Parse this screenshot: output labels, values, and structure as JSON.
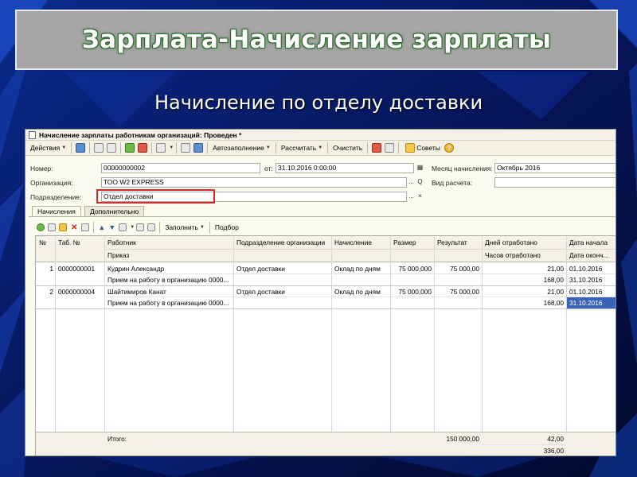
{
  "slide": {
    "title": "Зарплата-Начисление зарплаты",
    "subtitle": "Начисление по отделу доставки",
    "colors": {
      "title_bg": "#a6a6a6",
      "title_glow": "#2e6b2e",
      "background": "#04103a"
    }
  },
  "window": {
    "title": "Начисление зарплаты работникам организаций: Проведен *"
  },
  "toolbar": {
    "actions_label": "Действия",
    "autofill_label": "Автозаполнение",
    "calculate_label": "Рассчитать",
    "clear_label": "Очистить",
    "tips_label": "Советы",
    "help_symbol": "?"
  },
  "form": {
    "number_label": "Номер:",
    "number_value": "00000000002",
    "date_label": "от:",
    "date_value": "31.10.2016  0:00:00",
    "month_label": "Месяц начисления:",
    "month_value": "Октябрь 2016",
    "org_label": "Организация:",
    "org_value": "ТОО W2 EXPRESS",
    "calc_type_label": "Вид расчета:",
    "calc_type_value": "",
    "dept_label": "Подразделение:",
    "dept_value": "Отдел доставки",
    "select_button": "...",
    "search_button": "Q",
    "clear_button": "×"
  },
  "tabs": [
    {
      "label": "Начисления",
      "active": true
    },
    {
      "label": "Дополнительно",
      "active": false
    }
  ],
  "table_toolbar": {
    "fill_label": "Заполнить",
    "pick_label": "Подбор"
  },
  "table": {
    "headers": {
      "num": "№",
      "tab_num": "Таб. №",
      "employee": "Работник",
      "order": "Приказ",
      "department": "Подразделение организации",
      "accrual": "Начисление",
      "size": "Размер",
      "result": "Результат",
      "days_worked": "Дней отработано",
      "hours_worked": "Часов отработано",
      "date_start": "Дата начала",
      "date_end": "Дата оконч..."
    },
    "rows": [
      {
        "num": "1",
        "tab_num": "0000000001",
        "employee": "Кудрин Александр",
        "order": "Прием на работу в организацию 0000...",
        "department": "Отдел доставки",
        "accrual": "Оклад по дням",
        "size": "75 000,000",
        "result": "75 000,00",
        "days_worked": "21,00",
        "hours_worked": "168,00",
        "date_start": "01.10.2016",
        "date_end": "31.10.2016"
      },
      {
        "num": "2",
        "tab_num": "0000000004",
        "employee": "Шайтимиров Канат",
        "order": "Прием на работу в организацию 0000...",
        "department": "Отдел доставки",
        "accrual": "Оклад по дням",
        "size": "75 000,000",
        "result": "75 000,00",
        "days_worked": "21,00",
        "hours_worked": "168,00",
        "date_start": "01.10.2016",
        "date_end": "31.10.2016"
      }
    ],
    "totals": {
      "label": "Итого:",
      "result": "150 000,00",
      "days_worked": "42,00",
      "hours_worked": "336,00"
    }
  }
}
